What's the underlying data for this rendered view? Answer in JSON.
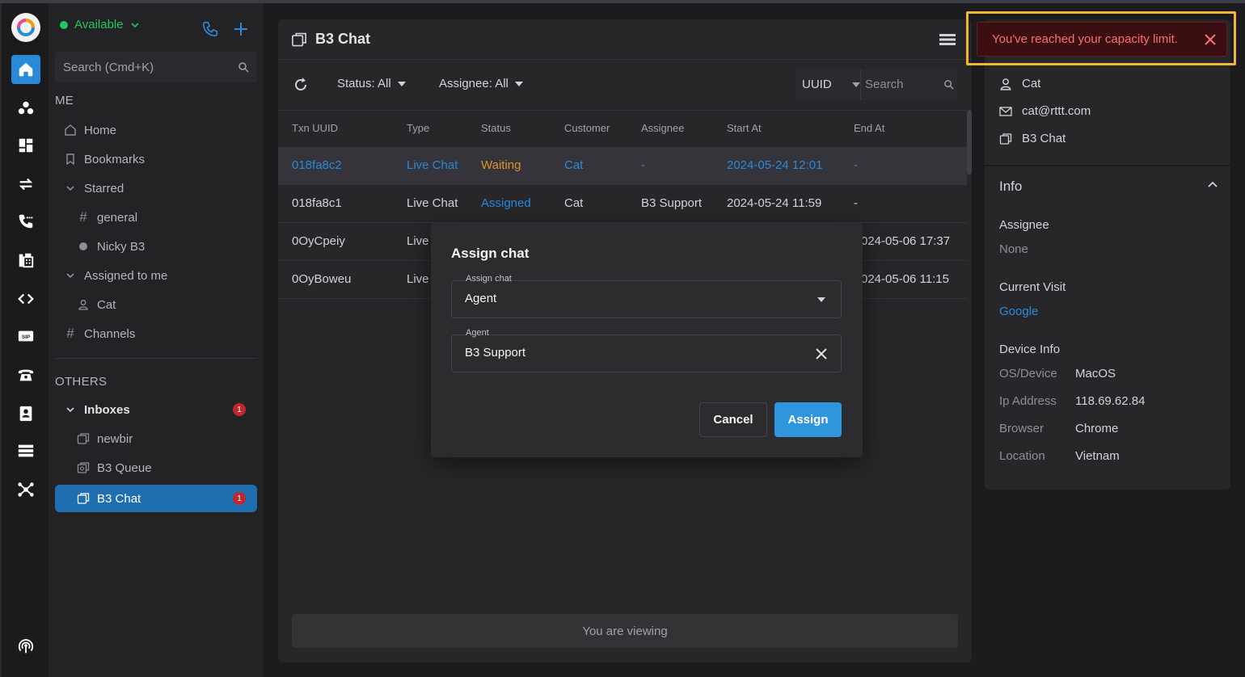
{
  "status": {
    "label": "Available"
  },
  "sidebar": {
    "search_placeholder": "Search (Cmd+K)",
    "me_header": "ME",
    "others_header": "OTHERS",
    "items": {
      "home": "Home",
      "bookmarks": "Bookmarks",
      "starred": "Starred",
      "general": "general",
      "nicky": "Nicky B3",
      "assigned_to_me": "Assigned to me",
      "cat": "Cat",
      "channels": "Channels",
      "inboxes": "Inboxes",
      "inboxes_badge": "1",
      "newbir": "newbir",
      "b3_queue": "B3 Queue",
      "b3_chat": "B3 Chat",
      "b3_chat_badge": "1"
    }
  },
  "main": {
    "title": "B3 Chat",
    "status_filter": "Status: All",
    "assignee_filter": "Assignee: All",
    "uuid_select": "UUID",
    "search_placeholder": "Search",
    "columns": [
      "Txn UUID",
      "Type",
      "Status",
      "Customer",
      "Assignee",
      "Start At",
      "End At"
    ],
    "rows": [
      {
        "uuid": "018fa8c2",
        "type": "Live Chat",
        "status": "Waiting",
        "customer": "Cat",
        "assignee": "-",
        "start": "2024-05-24 12:01",
        "end": "-"
      },
      {
        "uuid": "018fa8c1",
        "type": "Live Chat",
        "status": "Assigned",
        "customer": "Cat",
        "assignee": "B3 Support",
        "start": "2024-05-24 11:59",
        "end": "-"
      },
      {
        "uuid": "0OyCpeiy",
        "type": "Live",
        "start": "024-05-06 17:37"
      },
      {
        "uuid": "0OyBoweu",
        "type": "Live",
        "start": "024-05-06 11:15"
      }
    ],
    "viewing_text": "You are viewing"
  },
  "modal": {
    "title": "Assign chat",
    "assign_label": "Assign chat",
    "assign_value": "Agent",
    "agent_label": "Agent",
    "agent_value": "B3 Support",
    "cancel_label": "Cancel",
    "assign_button": "Assign"
  },
  "alert": {
    "text": "You've reached your capacity limit."
  },
  "right_panel": {
    "name": "Cat",
    "email": "cat@rttt.com",
    "inbox": "B3 Chat",
    "info_title": "Info",
    "assignee_label": "Assignee",
    "assignee_value": "None",
    "current_visit_label": "Current Visit",
    "current_visit_value": "Google",
    "device_info_label": "Device Info",
    "os_label": "OS/Device",
    "os_value": "MacOS",
    "ip_label": "Ip Address",
    "ip_value": "118.69.62.84",
    "browser_label": "Browser",
    "browser_value": "Chrome",
    "location_label": "Location",
    "location_value": "Vietnam"
  },
  "colors": {
    "accent": "#2b8ad8",
    "waiting": "#e0922d",
    "alert_text": "#f87171",
    "highlight": "#f2b437",
    "online": "#22c55e"
  }
}
